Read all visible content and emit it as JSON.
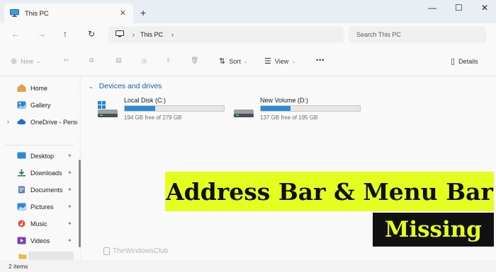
{
  "window": {
    "tab_title": "This PC",
    "tab_close": "✕",
    "new_tab": "+",
    "minimize": "—",
    "maximize": "☐",
    "close": "✕"
  },
  "nav": {
    "back": "←",
    "forward": "→",
    "up": "↑",
    "refresh": "↻",
    "path_icon": "monitor-icon",
    "path_label": "This PC",
    "path_sep": "›",
    "search_placeholder": "Search This PC"
  },
  "commands": {
    "new_label": "New",
    "sort_label": "Sort",
    "view_label": "View",
    "more_label": "•••",
    "details_label": "Details"
  },
  "sidebar": {
    "items": [
      {
        "label": "Home",
        "icon": "home-icon"
      },
      {
        "label": "Gallery",
        "icon": "gallery-icon"
      },
      {
        "label": "OneDrive - Perso",
        "icon": "cloud-icon"
      },
      {
        "label": "Desktop",
        "icon": "desktop-icon"
      },
      {
        "label": "Downloads",
        "icon": "download-icon"
      },
      {
        "label": "Documents",
        "icon": "documents-icon"
      },
      {
        "label": "Pictures",
        "icon": "pictures-icon"
      },
      {
        "label": "Music",
        "icon": "music-icon"
      },
      {
        "label": "Videos",
        "icon": "videos-icon"
      }
    ],
    "pin_glyph": "📌"
  },
  "content": {
    "group_title": "Devices and drives",
    "drives": [
      {
        "name": "Local Disk (C:)",
        "free_text": "194 GB free of 279 GB",
        "used_fraction": 0.305
      },
      {
        "name": "New Volume (D:)",
        "free_text": "137 GB free of 195 GB",
        "used_fraction": 0.297
      }
    ]
  },
  "status": {
    "items_count": "2 items"
  },
  "watermark": "TheWindowsClub",
  "overlay": {
    "headline": "Address Bar & Menu Bar",
    "subline": "Missing"
  },
  "colors": {
    "accent": "#2f8ad6",
    "banner_yellow": "#e4ff1f",
    "banner_black": "#111111"
  }
}
